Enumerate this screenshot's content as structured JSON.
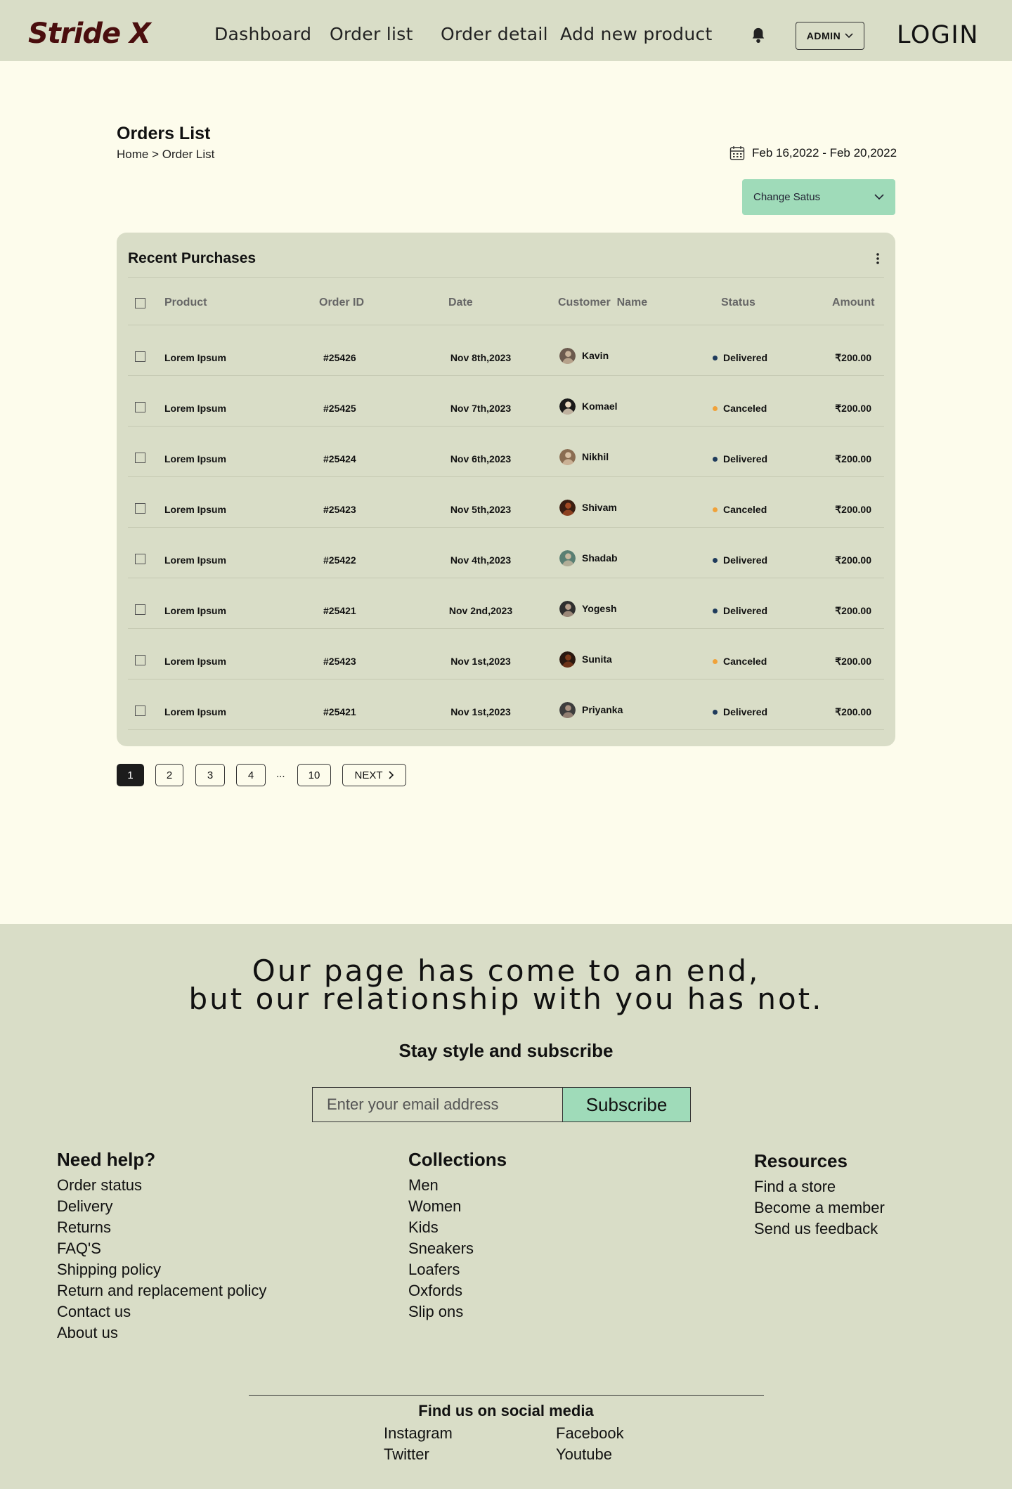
{
  "nav": {
    "logo": "Stride X",
    "links": [
      "Dashboard",
      "Order list",
      "Order detail",
      "Add new product"
    ],
    "admin_label": "ADMIN",
    "login_label": "LOGIN"
  },
  "page": {
    "title": "Orders List",
    "breadcrumb": "Home > Order List",
    "date_range": "Feb 16,2022 - Feb 20,2022",
    "status_select": "Change Satus"
  },
  "table": {
    "title": "Recent Purchases",
    "headers": [
      "Product",
      "Order ID",
      "Date",
      "Customer  Name",
      "Status",
      "Amount"
    ],
    "rows": [
      {
        "product": "Lorem Ipsum",
        "order_id": "#25426",
        "date": "Nov 8th,2023",
        "customer": "Kavin",
        "status": "Delivered",
        "amount": "₹200.00"
      },
      {
        "product": "Lorem Ipsum",
        "order_id": "#25425",
        "date": "Nov 7th,2023",
        "customer": "Komael",
        "status": "Canceled",
        "amount": "₹200.00"
      },
      {
        "product": "Lorem Ipsum",
        "order_id": "#25424",
        "date": "Nov 6th,2023",
        "customer": "Nikhil",
        "status": "Delivered",
        "amount": "₹200.00"
      },
      {
        "product": "Lorem Ipsum",
        "order_id": "#25423",
        "date": "Nov 5th,2023",
        "customer": "Shivam",
        "status": "Canceled",
        "amount": "₹200.00"
      },
      {
        "product": "Lorem Ipsum",
        "order_id": "#25422",
        "date": "Nov 4th,2023",
        "customer": "Shadab",
        "status": "Delivered",
        "amount": "₹200.00"
      },
      {
        "product": "Lorem Ipsum",
        "order_id": "#25421",
        "date": "Nov 2nd,2023",
        "customer": "Yogesh",
        "status": "Delivered",
        "amount": "₹200.00"
      },
      {
        "product": "Lorem Ipsum",
        "order_id": "#25423",
        "date": "Nov 1st,2023",
        "customer": "Sunita",
        "status": "Canceled",
        "amount": "₹200.00"
      },
      {
        "product": "Lorem Ipsum",
        "order_id": "#25421",
        "date": "Nov 1st,2023",
        "customer": "Priyanka",
        "status": "Delivered",
        "amount": "₹200.00"
      }
    ]
  },
  "colors": {
    "delivered": "#1f3b5c",
    "canceled": "#f0a23a",
    "accent": "#9fdbb9",
    "panel": "#d9ddc7",
    "background": "#fdfcec",
    "logo": "#4a0e0e"
  },
  "pagination": {
    "pages": [
      "1",
      "2",
      "3",
      "4",
      "10"
    ],
    "ellipsis": "...",
    "next": "NEXT",
    "current": "1"
  },
  "footer": {
    "tagline_line1": "Our page has come to an end,",
    "tagline_line2": "but our relationship with you has not.",
    "subscribe_heading": "Stay style and subscribe",
    "email_placeholder": "Enter your email address",
    "subscribe_button": "Subscribe",
    "help": {
      "heading": "Need help?",
      "items": [
        "Order status",
        "Delivery",
        "Returns",
        "FAQ'S",
        "Shipping policy",
        "Return and replacement policy",
        "Contact us",
        "About us"
      ]
    },
    "collections": {
      "heading": "Collections",
      "items": [
        "Men",
        "Women",
        "Kids",
        "Sneakers",
        "Loafers",
        "Oxfords",
        "Slip ons"
      ]
    },
    "resources": {
      "heading": "Resources",
      "items": [
        "Find a store",
        "Become a member",
        "Send us feedback"
      ]
    },
    "social": {
      "heading": "Find us on social media",
      "links": [
        "Instagram",
        "Facebook",
        "Twitter",
        "Youtube"
      ]
    }
  },
  "icons": {
    "bell": "bell-icon",
    "calendar": "calendar-icon",
    "chevron": "chevron-down-icon",
    "kebab": "kebab-menu-icon"
  }
}
